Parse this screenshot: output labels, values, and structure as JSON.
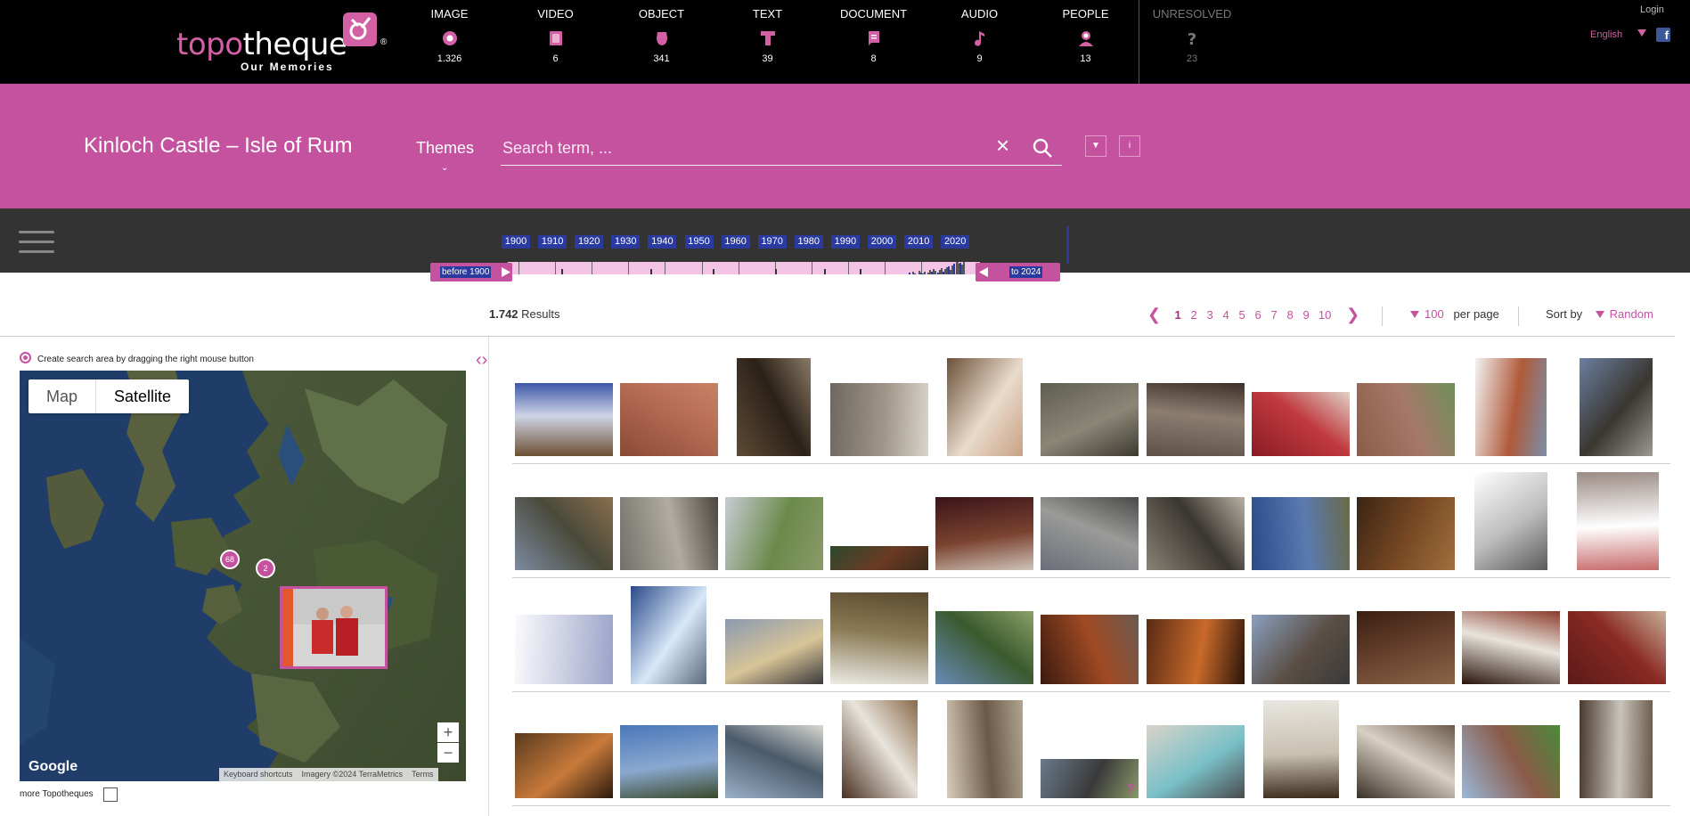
{
  "header": {
    "logo_word_a": "topo",
    "logo_word_b": "theque",
    "logo_sub": "Our Memories",
    "logo_reg": "®",
    "login": "Login",
    "language": "English",
    "facebook": "f",
    "categories": [
      {
        "label": "IMAGE",
        "count": "1.326",
        "icon": "image-icon"
      },
      {
        "label": "VIDEO",
        "count": "6",
        "icon": "video-icon"
      },
      {
        "label": "OBJECT",
        "count": "341",
        "icon": "object-icon"
      },
      {
        "label": "TEXT",
        "count": "39",
        "icon": "text-icon"
      },
      {
        "label": "DOCUMENT",
        "count": "8",
        "icon": "document-icon"
      },
      {
        "label": "AUDIO",
        "count": "9",
        "icon": "audio-icon"
      },
      {
        "label": "PEOPLE",
        "count": "13",
        "icon": "people-icon"
      },
      {
        "label": "UNRESOLVED",
        "count": "23",
        "icon": "question-icon"
      }
    ]
  },
  "search_bar": {
    "site_title": "Kinloch Castle – Isle of Rum",
    "themes_label": "Themes",
    "placeholder": "Search term, ...",
    "info_label": "i"
  },
  "timeline": {
    "years": [
      "1900",
      "1910",
      "1920",
      "1930",
      "1940",
      "1950",
      "1960",
      "1970",
      "1980",
      "1990",
      "2000",
      "2010",
      "2020"
    ],
    "before_label": "before 1900",
    "after_label": "to 2024"
  },
  "results_bar": {
    "count": "1.742",
    "count_suffix": " Results",
    "pages": [
      "1",
      "2",
      "3",
      "4",
      "5",
      "6",
      "7",
      "8",
      "9",
      "10"
    ],
    "current_page": "1",
    "per_page_value": "100",
    "per_page_label": "per page",
    "sort_label": "Sort by",
    "sort_value": "Random"
  },
  "map": {
    "hint": "Create search area by dragging the right mouse button",
    "mode_map": "Map",
    "mode_satellite": "Satellite",
    "active_mode": "Satellite",
    "clusters": [
      "68",
      "2"
    ],
    "zoom_in": "+",
    "zoom_out": "−",
    "google_label": "Google",
    "footer": [
      "Keyboard shortcuts",
      "Imagery ©2024 TerraMetrics",
      "Terms"
    ],
    "more_label": "more Topotheques"
  },
  "colors": {
    "accent": "#c4529f",
    "timeline_blue": "#2a3a9e",
    "topbar": "#000000",
    "timebar": "#333333"
  }
}
